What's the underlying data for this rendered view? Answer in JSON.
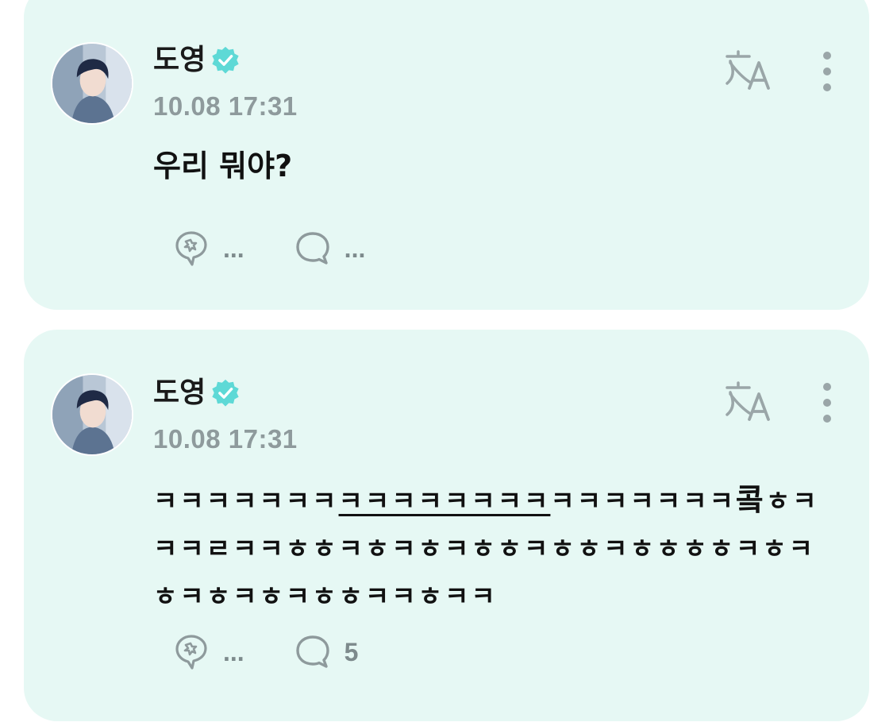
{
  "posts": [
    {
      "author": "도영",
      "timestamp": "10.08 17:31",
      "text": "우리 뭐야?",
      "reaction_count": "...",
      "comment_count": "..."
    },
    {
      "author": "도영",
      "timestamp": "10.08 17:31",
      "text_part1": "ㅋㅋㅋㅋㅋㅋㅋ",
      "text_underlined": "ㅋㅋㅋㅋㅋㅋㅋㅋ",
      "text_part2": "ㅋㅋㅋㅋㅋㅋㅋ",
      "text_bold_char": "콬",
      "text_part3": "ㅎㅋㅋㅋㄹㅋㅋㅎㅎㅋㅎㅋㅎㅋㅎㅎㅋㅎㅎㅋㅎㅎㅎㅎㅋㅎㅋㅎㅋㅎㅋㅎㅋㅎㅎㅋㅋㅎㅋㅋ",
      "reaction_count": "...",
      "comment_count": "5"
    }
  ],
  "icons": {
    "verified": "verified-badge-icon",
    "translate": "translate-icon",
    "more": "more-vertical-icon",
    "reaction": "reaction-icon",
    "comment": "comment-bubble-icon"
  },
  "colors": {
    "card_background": "#e6f8f4",
    "verified_badge": "#5ed9d6",
    "icon_gray": "#8e9a9c",
    "text": "#111111"
  }
}
